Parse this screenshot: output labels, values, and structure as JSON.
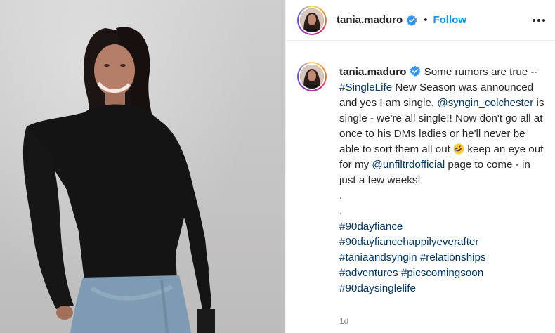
{
  "header": {
    "username": "tania.maduro",
    "separator": "•",
    "follow_label": "Follow",
    "more_icon": "ellipsis-icon"
  },
  "caption": {
    "username": "tania.maduro",
    "text_1": " Some rumors are true -- ",
    "hashtag_singlelife": "#SingleLife",
    "text_2": " New Season was announced and yes I am single, ",
    "mention_syngin": "@syngin_colchester",
    "text_3": " is single - we're all single!! Now don't go all at once to his DMs ladies or he'll never be able to sort them all out ",
    "emoji": "rolling-on-floor-laughing-emoji",
    "text_4": " keep an eye out for my ",
    "mention_unfiltrd": "@unfiltrdofficial",
    "text_5": " page to come - in just a few weeks!",
    "dot_1": ".",
    "dot_2": ".",
    "hashtags": [
      "#90dayfiance",
      "#90dayfiancehappilyeverafter",
      "#taniaandsyngin",
      "#relationships",
      "#adventures",
      "#picscomingsoon",
      "#90daysinglelife"
    ]
  },
  "timestamp": "1d",
  "colors": {
    "link_blue": "#0095f6",
    "hashtag_navy": "#00376b",
    "text": "#262626",
    "muted": "#8e8e8e",
    "verified_blue": "#3897f0"
  }
}
